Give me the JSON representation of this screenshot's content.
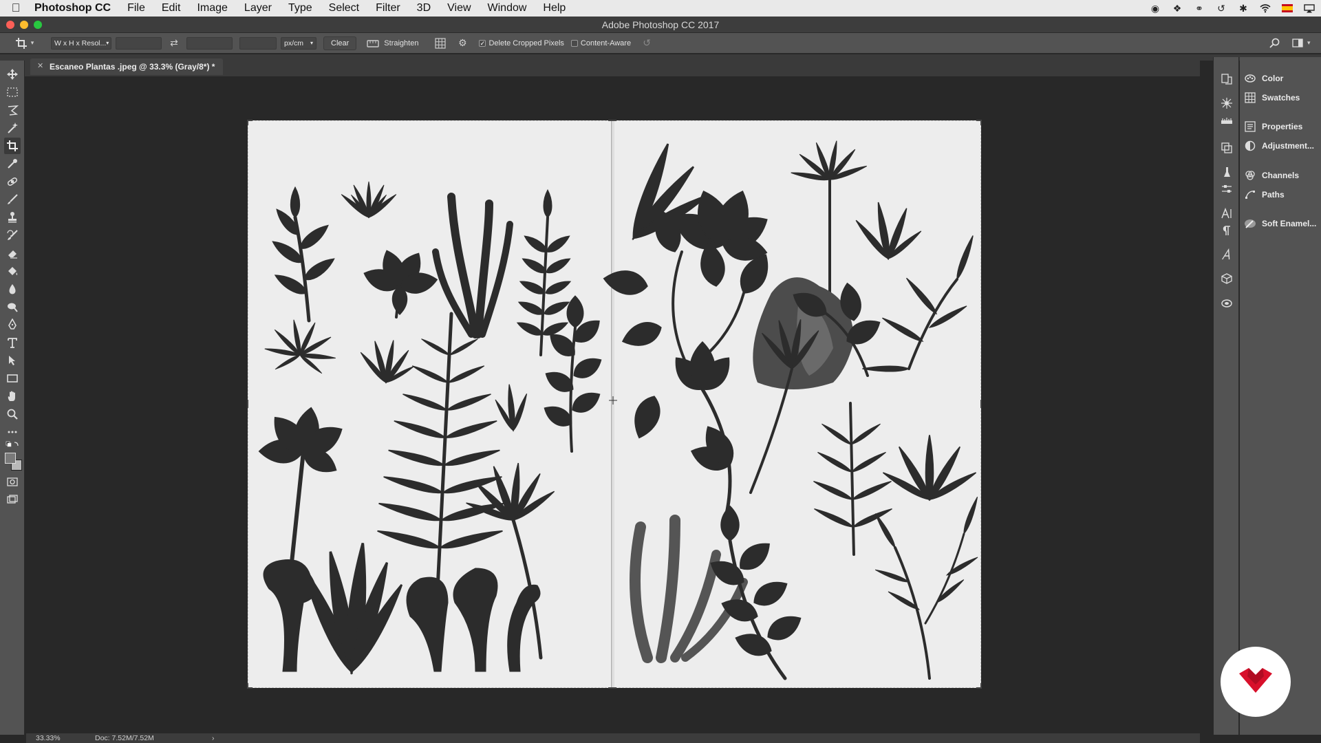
{
  "menubar": {
    "app": "Photoshop CC",
    "items": [
      "File",
      "Edit",
      "Image",
      "Layer",
      "Type",
      "Select",
      "Filter",
      "3D",
      "View",
      "Window",
      "Help"
    ]
  },
  "window": {
    "title": "Adobe Photoshop CC 2017"
  },
  "options": {
    "ratio_select": "W x H x Resol...",
    "units_select": "px/cm",
    "clear": "Clear",
    "straighten": "Straighten",
    "delete_cropped": "Delete Cropped Pixels",
    "delete_cropped_checked": true,
    "content_aware": "Content-Aware",
    "content_aware_checked": false
  },
  "document": {
    "tab_title": "Escaneo Plantas .jpeg @ 33.3% (Gray/8*) *"
  },
  "panels": {
    "items": [
      "Color",
      "Swatches",
      "Properties",
      "Adjustment...",
      "Channels",
      "Paths",
      "Soft Enamel..."
    ]
  },
  "status": {
    "zoom": "33.33%",
    "doc": "Doc: 7.52M/7.52M",
    "arrow": "›"
  },
  "colors": {
    "brand": "#d8102b",
    "chrome": "#535353",
    "canvas": "#282828"
  }
}
